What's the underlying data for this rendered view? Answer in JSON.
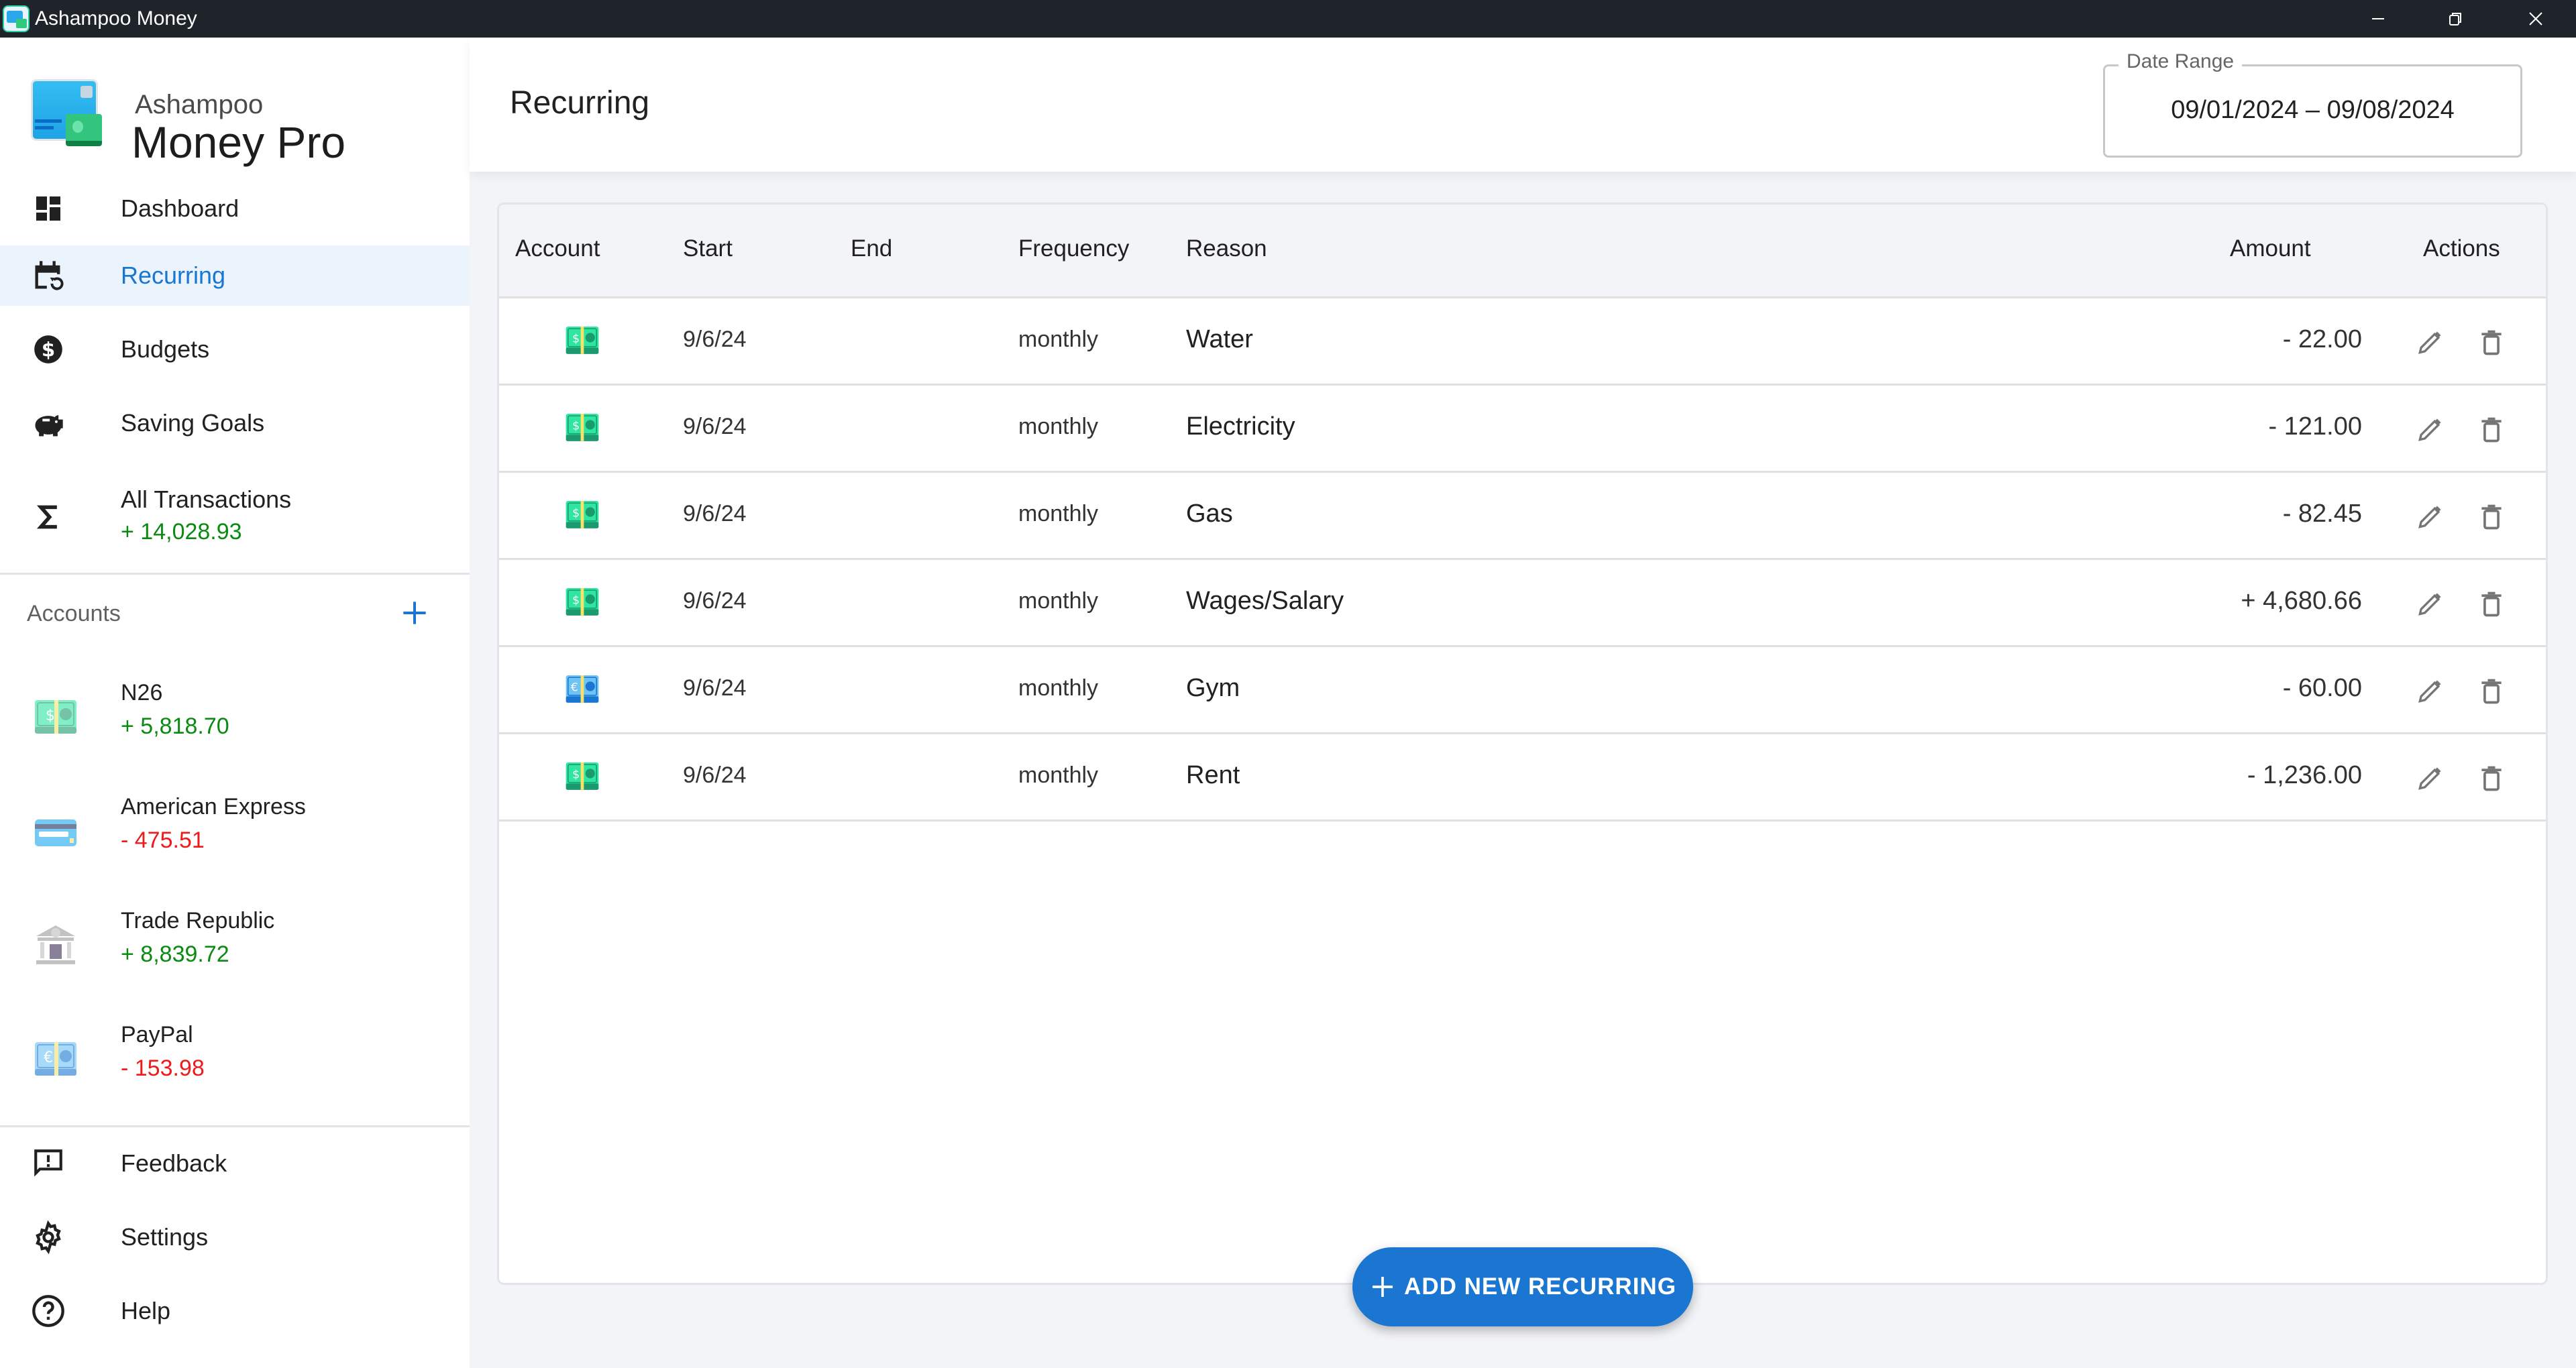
{
  "window": {
    "title": "Ashampoo Money",
    "controls": {
      "minimize": "–",
      "restore": "❐",
      "close": "✕"
    }
  },
  "brand": {
    "top": "Ashampoo",
    "main": "Money Pro"
  },
  "sidebar": {
    "nav": [
      {
        "label": "Dashboard",
        "icon": "dashboard-icon"
      },
      {
        "label": "Recurring",
        "icon": "calendar-recurring-icon",
        "active": true
      },
      {
        "label": "Budgets",
        "icon": "dollar-circle-icon"
      },
      {
        "label": "Saving Goals",
        "icon": "piggy-bank-icon"
      },
      {
        "label": "All Transactions",
        "icon": "sigma-icon",
        "sub": "+ 14,028.93"
      }
    ],
    "accounts_heading": "Accounts",
    "add_account_icon": "plus-icon",
    "accounts": [
      {
        "name": "N26",
        "balance": "+ 5,818.70",
        "sign": "positive",
        "icon": "dollar-bill-icon"
      },
      {
        "name": "American Express",
        "balance": "- 475.51",
        "sign": "negative",
        "icon": "credit-card-icon"
      },
      {
        "name": "Trade Republic",
        "balance": "+ 8,839.72",
        "sign": "positive",
        "icon": "bank-icon"
      },
      {
        "name": "PayPal",
        "balance": "- 153.98",
        "sign": "negative",
        "icon": "euro-bill-icon"
      }
    ],
    "footer": [
      {
        "label": "Feedback",
        "icon": "feedback-icon"
      },
      {
        "label": "Settings",
        "icon": "gear-icon"
      },
      {
        "label": "Help",
        "icon": "help-icon"
      }
    ]
  },
  "header": {
    "title": "Recurring",
    "date_range": {
      "label": "Date Range",
      "value": "09/01/2024 – 09/08/2024"
    }
  },
  "table": {
    "columns": [
      "Account",
      "Start",
      "End",
      "Frequency",
      "Reason",
      "Amount",
      "Actions"
    ],
    "rows": [
      {
        "account_icon": "dollar-bill-icon",
        "start": "9/6/24",
        "end": "",
        "frequency": "monthly",
        "reason": "Water",
        "amount": "- 22.00",
        "sign": "negative"
      },
      {
        "account_icon": "dollar-bill-icon",
        "start": "9/6/24",
        "end": "",
        "frequency": "monthly",
        "reason": "Electricity",
        "amount": "- 121.00",
        "sign": "negative"
      },
      {
        "account_icon": "dollar-bill-icon",
        "start": "9/6/24",
        "end": "",
        "frequency": "monthly",
        "reason": "Gas",
        "amount": "- 82.45",
        "sign": "negative"
      },
      {
        "account_icon": "dollar-bill-icon",
        "start": "9/6/24",
        "end": "",
        "frequency": "monthly",
        "reason": "Wages/Salary",
        "amount": "+ 4,680.66",
        "sign": "positive"
      },
      {
        "account_icon": "euro-bill-icon",
        "start": "9/6/24",
        "end": "",
        "frequency": "monthly",
        "reason": "Gym",
        "amount": "- 60.00",
        "sign": "negative"
      },
      {
        "account_icon": "dollar-bill-icon",
        "start": "9/6/24",
        "end": "",
        "frequency": "monthly",
        "reason": "Rent",
        "amount": "- 1,236.00",
        "sign": "negative"
      }
    ]
  },
  "add_button": {
    "label": "ADD NEW RECURRING",
    "icon": "plus-icon"
  },
  "colors": {
    "accent": "#1b76d2",
    "positive": "#0b8a12",
    "negative": "#ef1a1a",
    "titlebar": "#1f232a",
    "active_nav_bg": "#ebf3fc"
  }
}
